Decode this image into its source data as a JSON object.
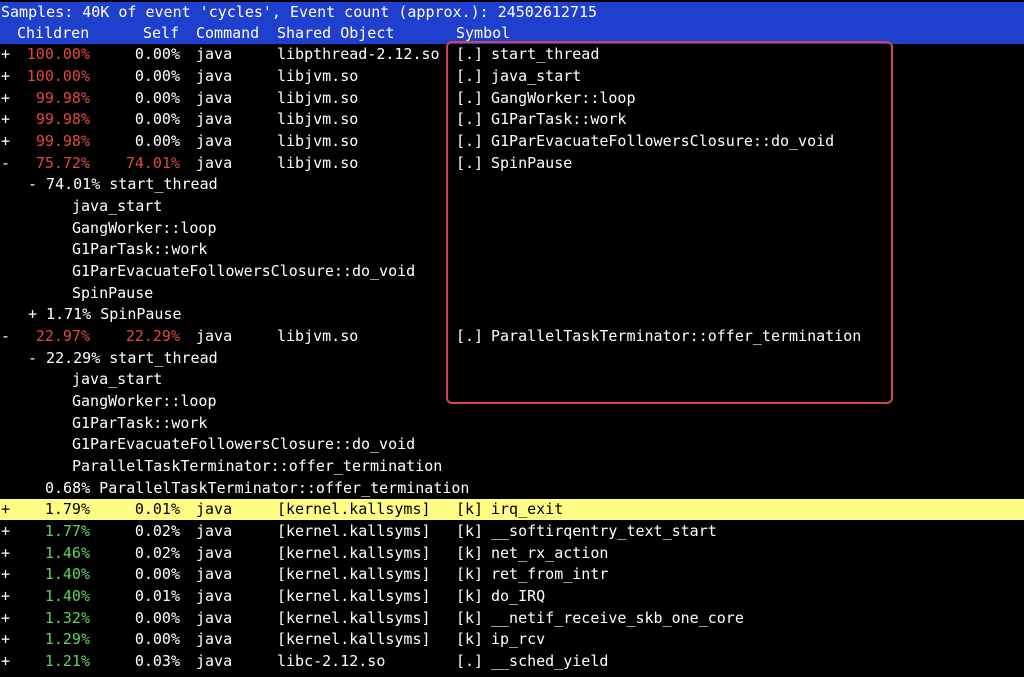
{
  "summary": "Samples: 40K of event 'cycles', Event count (approx.): 24502612715",
  "columns": {
    "children": "Children",
    "self": "Self",
    "command": "Command",
    "shared_object": "Shared Object",
    "symbol": "Symbol"
  },
  "colors": {
    "header_bg": "#1f3fcf",
    "highlight_bg": "#fefe86",
    "high_overhead": "#e2483f",
    "low_overhead": "#5fd35f",
    "selection_box": "#d7434a"
  },
  "rows": [
    {
      "expander": "+",
      "children": "100.00%",
      "self": "0.00%",
      "command": "java",
      "dso": "libpthread-2.12.so",
      "type": "[.]",
      "symbol": "start_thread",
      "children_color": "red"
    },
    {
      "expander": "+",
      "children": "100.00%",
      "self": "0.00%",
      "command": "java",
      "dso": "libjvm.so",
      "type": "[.]",
      "symbol": "java_start",
      "children_color": "red"
    },
    {
      "expander": "+",
      "children": "99.98%",
      "self": "0.00%",
      "command": "java",
      "dso": "libjvm.so",
      "type": "[.]",
      "symbol": "GangWorker::loop",
      "children_color": "red"
    },
    {
      "expander": "+",
      "children": "99.98%",
      "self": "0.00%",
      "command": "java",
      "dso": "libjvm.so",
      "type": "[.]",
      "symbol": "G1ParTask::work",
      "children_color": "red"
    },
    {
      "expander": "+",
      "children": "99.98%",
      "self": "0.00%",
      "command": "java",
      "dso": "libjvm.so",
      "type": "[.]",
      "symbol": "G1ParEvacuateFollowersClosure::do_void",
      "children_color": "red"
    },
    {
      "expander": "-",
      "children": "75.72%",
      "self": "74.01%",
      "command": "java",
      "dso": "libjvm.so",
      "type": "[.]",
      "symbol": "SpinPause",
      "children_color": "red",
      "self_color": "red"
    }
  ],
  "tree1": {
    "root": "- 74.01% start_thread",
    "frames": [
      "java_start",
      "GangWorker::loop",
      "G1ParTask::work",
      "G1ParEvacuateFollowersClosure::do_void",
      "SpinPause"
    ],
    "sibling": "+ 1.71% SpinPause"
  },
  "row_termination": {
    "expander": "-",
    "children": "22.97%",
    "self": "22.29%",
    "command": "java",
    "dso": "libjvm.so",
    "type": "[.]",
    "symbol": "ParallelTaskTerminator::offer_termination"
  },
  "tree2": {
    "root": "- 22.29% start_thread",
    "frames": [
      "java_start",
      "GangWorker::loop",
      "G1ParTask::work",
      "G1ParEvacuateFollowersClosure::do_void",
      "ParallelTaskTerminator::offer_termination"
    ],
    "sibling": "0.68% ParallelTaskTerminator::offer_termination"
  },
  "kernel_rows": [
    {
      "expander": "+",
      "children": "1.79%",
      "self": "0.01%",
      "command": "java",
      "dso": "[kernel.kallsyms]",
      "type": "[k]",
      "symbol": "irq_exit",
      "selected": true
    },
    {
      "expander": "+",
      "children": "1.77%",
      "self": "0.02%",
      "command": "java",
      "dso": "[kernel.kallsyms]",
      "type": "[k]",
      "symbol": "__softirqentry_text_start"
    },
    {
      "expander": "+",
      "children": "1.46%",
      "self": "0.02%",
      "command": "java",
      "dso": "[kernel.kallsyms]",
      "type": "[k]",
      "symbol": "net_rx_action"
    },
    {
      "expander": "+",
      "children": "1.40%",
      "self": "0.00%",
      "command": "java",
      "dso": "[kernel.kallsyms]",
      "type": "[k]",
      "symbol": "ret_from_intr"
    },
    {
      "expander": "+",
      "children": "1.40%",
      "self": "0.01%",
      "command": "java",
      "dso": "[kernel.kallsyms]",
      "type": "[k]",
      "symbol": "do_IRQ"
    },
    {
      "expander": "+",
      "children": "1.32%",
      "self": "0.00%",
      "command": "java",
      "dso": "[kernel.kallsyms]",
      "type": "[k]",
      "symbol": "__netif_receive_skb_one_core"
    },
    {
      "expander": "+",
      "children": "1.29%",
      "self": "0.00%",
      "command": "java",
      "dso": "[kernel.kallsyms]",
      "type": "[k]",
      "symbol": "ip_rcv"
    },
    {
      "expander": "+",
      "children": "1.21%",
      "self": "0.03%",
      "command": "java",
      "dso": "libc-2.12.so",
      "type": "[.]",
      "symbol": "__sched_yield"
    }
  ]
}
